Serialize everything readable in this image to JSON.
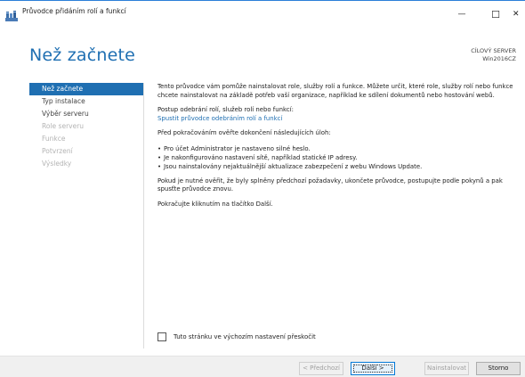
{
  "window": {
    "title": "Průvodce přidáním rolí a funkcí",
    "minimize_glyph": "—",
    "maximize_glyph": "☐",
    "close_glyph": "✕"
  },
  "header": {
    "title": "Než začnete",
    "target_label": "CÍLOVÝ SERVER",
    "target_server": "Win2016CZ"
  },
  "nav": {
    "items": [
      {
        "label": "Než začnete",
        "state": "active"
      },
      {
        "label": "Typ instalace",
        "state": "enabled"
      },
      {
        "label": "Výběr serveru",
        "state": "enabled"
      },
      {
        "label": "Role serveru",
        "state": "disabled"
      },
      {
        "label": "Funkce",
        "state": "disabled"
      },
      {
        "label": "Potvrzení",
        "state": "disabled"
      },
      {
        "label": "Výsledky",
        "state": "disabled"
      }
    ]
  },
  "content": {
    "intro": "Tento průvodce vám pomůže nainstalovat role, služby rolí a funkce. Můžete určit, které role, služby rolí nebo funkce chcete nainstalovat na základě potřeb vaší organizace, například ke sdílení dokumentů nebo hostování webů.",
    "remove_label": "Postup odebrání rolí, služeb rolí nebo funkcí:",
    "remove_link": "Spustit průvodce odebráním rolí a funkcí",
    "prereq_heading": "Před pokračováním ověřte dokončení následujících úloh:",
    "bullets": [
      "Pro účet Administrator je nastaveno silné heslo.",
      "Je nakonfigurováno nastavení sítě, například statické IP adresy.",
      "Jsou nainstalovány nejaktuálnější aktualizace zabezpečení z webu Windows Update."
    ],
    "verify_note": "Pokud je nutné ověřit, že byly splněny předchozí požadavky, ukončete průvodce, postupujte podle pokynů a pak spusťte průvodce znovu.",
    "continue_note": "Pokračujte kliknutím na tlačítko Další."
  },
  "skip_checkbox": {
    "label": "Tuto stránku ve výchozím nastavení přeskočit",
    "checked": false
  },
  "footer": {
    "prev_label": "< Předchozí",
    "next_label": "Další >",
    "install_label": "Nainstalovat",
    "cancel_label": "Storno"
  },
  "colors": {
    "accent": "#1f6fb2",
    "footer_bg": "#f0f0f0",
    "disabled_text": "#b4b4b4"
  },
  "icons": {
    "app": "server-manager-icon"
  }
}
